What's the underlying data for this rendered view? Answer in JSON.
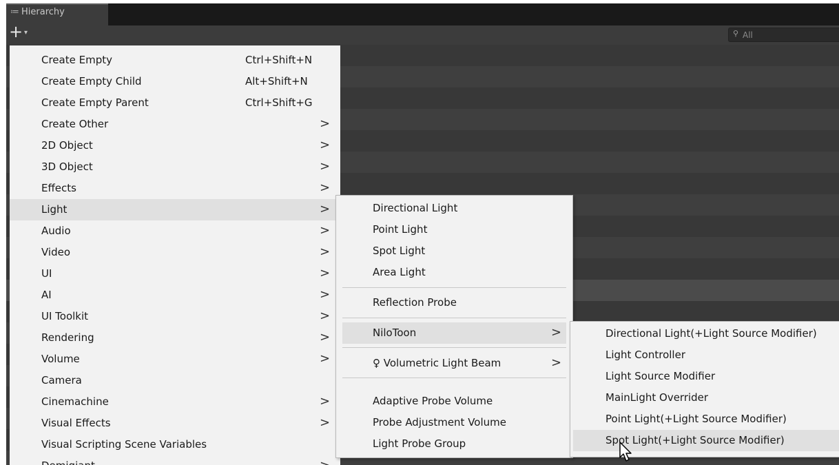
{
  "panel": {
    "tab_icon": "≔",
    "tab_title": "Hierarchy",
    "add_label": "+",
    "add_caret": "▾",
    "search_icon": "⚲",
    "search_placeholder": "All"
  },
  "colors": {
    "dark_row": "#383838",
    "light_row": "#3f3f3f",
    "selected_row": "#4b4b4b",
    "menu_bg": "#f2f2f2",
    "menu_highlight": "#e0e0e0"
  },
  "create_menu": {
    "items": [
      {
        "label": "Create Empty",
        "shortcut": "Ctrl+Shift+N"
      },
      {
        "label": "Create Empty Child",
        "shortcut": "Alt+Shift+N"
      },
      {
        "label": "Create Empty Parent",
        "shortcut": "Ctrl+Shift+G"
      },
      {
        "label": "Create Other",
        "arrow": ">"
      },
      {
        "label": "2D Object",
        "arrow": ">"
      },
      {
        "label": "3D Object",
        "arrow": ">"
      },
      {
        "label": "Effects",
        "arrow": ">"
      },
      {
        "label": "Light",
        "arrow": ">"
      },
      {
        "label": "Audio",
        "arrow": ">"
      },
      {
        "label": "Video",
        "arrow": ">"
      },
      {
        "label": "UI",
        "arrow": ">"
      },
      {
        "label": "AI",
        "arrow": ">"
      },
      {
        "label": "UI Toolkit",
        "arrow": ">"
      },
      {
        "label": "Rendering",
        "arrow": ">"
      },
      {
        "label": "Volume",
        "arrow": ">"
      },
      {
        "label": "Camera"
      },
      {
        "label": "Cinemachine",
        "arrow": ">"
      },
      {
        "label": "Visual Effects",
        "arrow": ">"
      },
      {
        "label": "Visual Scripting Scene Variables"
      },
      {
        "label": "Demigiant",
        "arrow": ">"
      }
    ]
  },
  "light_menu": {
    "items": [
      {
        "label": "Directional Light"
      },
      {
        "label": "Point Light"
      },
      {
        "label": "Spot Light"
      },
      {
        "label": "Area Light"
      },
      {
        "label": "Reflection Probe"
      },
      {
        "label": "NiloToon",
        "arrow": ">"
      },
      {
        "label": "♀ Volumetric Light Beam",
        "arrow": ">"
      },
      {
        "label": "Adaptive Probe Volume"
      },
      {
        "label": "Probe Adjustment Volume"
      },
      {
        "label": "Light Probe Group"
      }
    ]
  },
  "nilotoon_menu": {
    "items": [
      {
        "label": "Directional Light(+Light Source Modifier)"
      },
      {
        "label": "Light Controller"
      },
      {
        "label": "Light Source Modifier"
      },
      {
        "label": "MainLight Overrider"
      },
      {
        "label": "Point Light(+Light Source Modifier)"
      },
      {
        "label": "Spot Light(+Light Source Modifier)"
      }
    ]
  }
}
